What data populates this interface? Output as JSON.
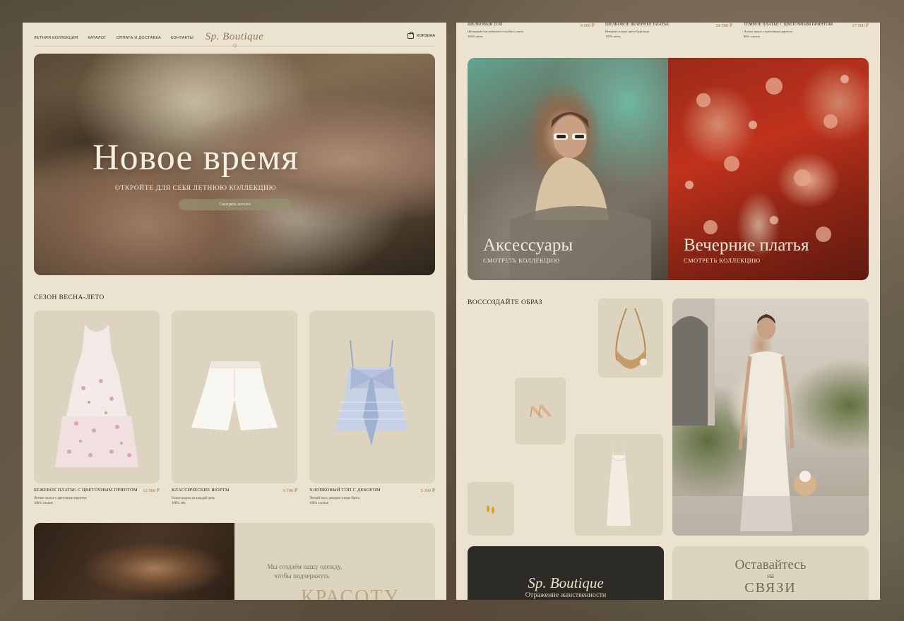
{
  "nav": {
    "links": [
      "ЛЕТНЯЯ КОЛЛЕКЦИЯ",
      "КАТАЛОГ",
      "ОПЛАТА И ДОСТАВКА",
      "КОНТАКТЫ"
    ],
    "logo": "Sp. Boutique",
    "cart_label": "КОРЗИНА",
    "cart_icon": "bag-icon"
  },
  "hero": {
    "title": "Новое время",
    "subtitle": "ОТКРОЙТЕ ДЛЯ СЕБЯ ЛЕТНЮЮ КОЛЛЕКЦИЮ",
    "button": "Смотреть каталог"
  },
  "season": {
    "title": "СЕЗОН ВЕСНА-ЛЕТО",
    "products": [
      {
        "name": "БЕЖЕВОЕ ПЛАТЬЕ С ЦВЕТОЧНЫМ ПРИНТОМ",
        "price": "12 500 ₽",
        "desc1": "Летнее платье с цветочным принтом",
        "desc2": "100% хлопок"
      },
      {
        "name": "КЛАССИЧЕСКИЕ ШОРТЫ",
        "price": "6 700 ₽",
        "desc1": "Белые шорты на каждый день",
        "desc2": "100% лён"
      },
      {
        "name": "ХЛОПКОВЫЙ ТОП С ДЕКОРОМ",
        "price": "5 300 ₽",
        "desc1": "Легкий топ с декором в виде банта",
        "desc2": "100% хлопок"
      }
    ]
  },
  "about": {
    "line1": "Мы создаём нашу одежду,",
    "line2": "чтобы подчеркнуть",
    "word": "красоту"
  },
  "strip": [
    {
      "name": "ШЁЛКОВЫЙ ТОП",
      "price": "9 300 ₽",
      "desc1": "Шёлковый топ небесного-голубого цвета",
      "desc2": "100% шёлк"
    },
    {
      "name": "ШЁЛКОВОЕ ВЕЧЕРНЕЕ ПЛАТЬЕ",
      "price": "24 500 ₽",
      "desc1": "Вечернее платье цвета бургунди",
      "desc2": "100% шёлк"
    },
    {
      "name": "ТЁМНОЕ ПЛАТЬЕ С ЦВЕТОЧНЫМ ПРИНТОМ",
      "price": "17 500 ₽",
      "desc1": "Платье макси с цветочным принтом",
      "desc2": "80% хлопок"
    }
  ],
  "collections": {
    "accessories": {
      "title": "Аксессуары",
      "link": "СМОТРЕТЬ КОЛЛЕКЦИЮ"
    },
    "evening": {
      "title": "Вечерние платья",
      "link": "СМОТРЕТЬ КОЛЛЕКЦИЮ"
    }
  },
  "look": {
    "title": "ВОССОЗДАЙТЕ ОБРАЗ"
  },
  "brand": {
    "logo": "Sp. Boutique",
    "tagline": "Отражение женственности"
  },
  "contact": {
    "line1": "Оставайтесь",
    "line2": "на",
    "line3": "связи"
  },
  "colors": {
    "panel": "#ebe3d0",
    "card": "#ddd4bf",
    "accent": "#8b7a55",
    "dark": "#2d2b25"
  }
}
